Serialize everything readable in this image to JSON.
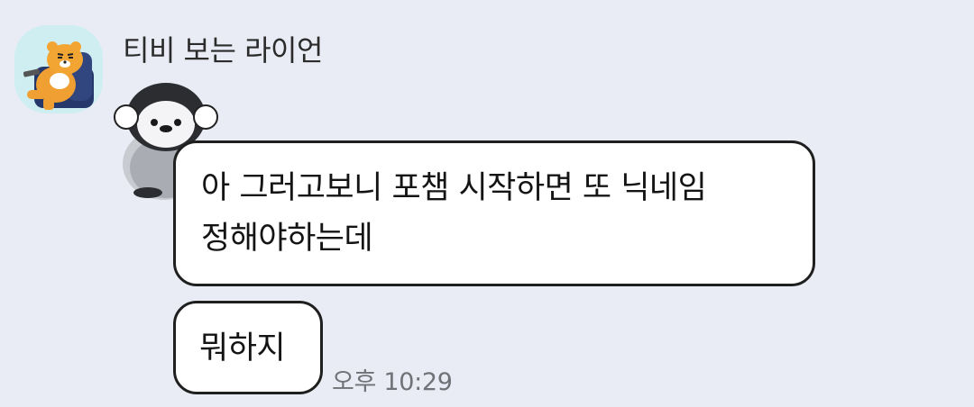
{
  "sender": {
    "name": "티비 보는 라이언",
    "avatar_icon": "ryan-lion-on-sofa-avatar"
  },
  "decoration": {
    "sticker_icon": "penguin-with-earmuffs-icon"
  },
  "messages": [
    {
      "lines": [
        "아 그러고보니 포챔 시작하면 또 닉네임",
        "정해야하는데"
      ]
    },
    {
      "lines": [
        "뭐하지"
      ],
      "time": "오후 10:29"
    }
  ],
  "colors": {
    "background": "#e9ecf4",
    "bubble": "#ffffff",
    "bubble_border": "#1f1f1f",
    "timestamp": "#6f7378"
  }
}
